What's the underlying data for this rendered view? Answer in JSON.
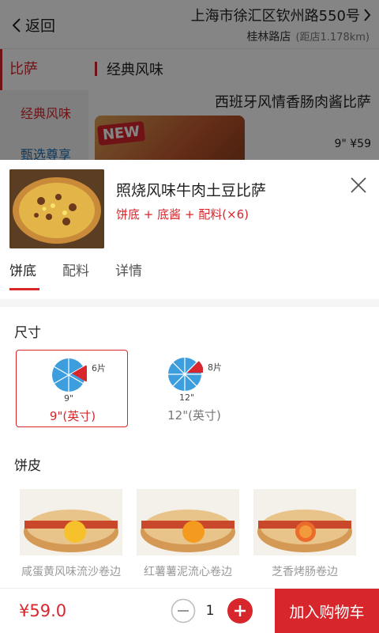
{
  "header": {
    "back_label": "返回",
    "store_address": "上海市徐汇区钦州路550号",
    "store_name": "桂林路店",
    "distance": "(距店1.178km)"
  },
  "side_nav": {
    "items": [
      {
        "label": "比萨"
      },
      {
        "label": "经典风味"
      },
      {
        "label": "甄选尊享"
      }
    ]
  },
  "background": {
    "section_title": "经典风味",
    "product_title": "西班牙风情香肠肉酱比萨",
    "new_badge": "NEW",
    "price": "9\" ¥59"
  },
  "product": {
    "name": "照烧风味牛肉土豆比萨",
    "desc": "饼底 + 底酱 + 配料(×6)"
  },
  "tabs": [
    {
      "label": "饼底"
    },
    {
      "label": "配料"
    },
    {
      "label": "详情"
    }
  ],
  "size_section": {
    "title": "尺寸",
    "options": [
      {
        "slices": "6片",
        "inch": "9\"",
        "label": "9\"(英寸)",
        "selected": true
      },
      {
        "slices": "8片",
        "inch": "12\"",
        "label": "12\"(英寸)",
        "selected": false
      }
    ]
  },
  "crust_section": {
    "title": "饼皮",
    "options": [
      {
        "label": "咸蛋黄风味流沙卷边",
        "filling": "yolk"
      },
      {
        "label": "红薯薯泥流心卷边",
        "filling": "sweet-potato"
      },
      {
        "label": "芝香烤肠卷边",
        "filling": "sausage"
      }
    ]
  },
  "bottom_bar": {
    "price": "¥59.0",
    "quantity": "1",
    "add_to_cart": "加入购物车"
  },
  "colors": {
    "accent": "#d7262c",
    "pie_blue": "#3d9ede"
  }
}
